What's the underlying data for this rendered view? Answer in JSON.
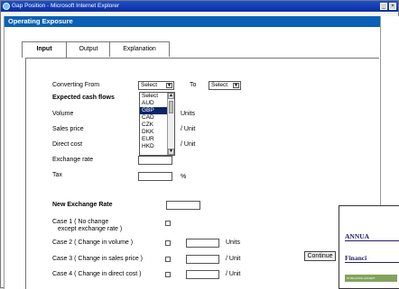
{
  "window": {
    "title": "Gap Position - Microsoft Internet Explorer",
    "minimize_label": "_",
    "close_label": "×"
  },
  "app": {
    "header": "Operating Exposure",
    "tabs": [
      "Input",
      "Output",
      "Explanation"
    ],
    "active_tab": "Input"
  },
  "form": {
    "converting_from_label": "Converting From",
    "to_label": "To",
    "from_select_value": "Select",
    "to_select_value": "Select",
    "currency_options": [
      "Select",
      "AUD",
      "GBP",
      "CAD",
      "CZK",
      "DKK",
      "EUR",
      "HKD"
    ],
    "highlighted_option": "GBP",
    "expected_cash_flows_label": "Expected cash flows",
    "volume_label": "Volume",
    "units_label": "Units",
    "sales_price_label": "Sales price",
    "per_unit_label": "/ Unit",
    "direct_cost_label": "Direct cost",
    "exchange_rate_label": "Exchange rate",
    "tax_label": "Tax",
    "percent_label": "%",
    "new_exchange_rate_label": "New Exchange Rate",
    "case1_label_line1": "Case 1 ( No change",
    "case1_label_line2": "except exchange rate )",
    "case2_label": "Case 2 ( Change in volume )",
    "case3_label": "Case 3 ( Change in sales price )",
    "case4_label": "Case 4 ( Change in direct cost )",
    "case2_unit": "Units",
    "case3_unit": "/ Unit",
    "case4_unit": "/ Unit",
    "continue_label": "Continue"
  },
  "background_doc": {
    "heading1": "ANNUA",
    "heading2": "Financi",
    "thumbnail_text": "IN MILLIONS, EXCEPT"
  },
  "colors": {
    "title_bar": "#0a2d9f",
    "app_header": "#0b61b7",
    "selection": "#0a246a"
  }
}
